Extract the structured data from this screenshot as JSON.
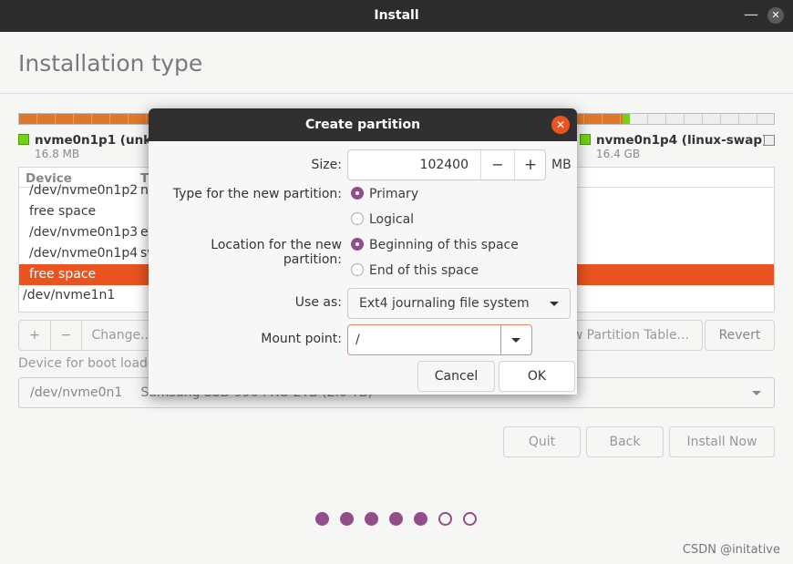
{
  "window": {
    "title": "Install"
  },
  "page": {
    "title": "Installation type"
  },
  "colors": {
    "accent": "#e95420",
    "ext4": "#f08a30",
    "swap": "#73d216",
    "progress": "#924d8b"
  },
  "legend": [
    {
      "name": "nvme0n1p1 (unkn",
      "size": "16.8 MB"
    },
    {
      "name": "nvme0n1p4 (linux-swap)",
      "size": "16.4 GB"
    }
  ],
  "table": {
    "headers": [
      "Device",
      "T"
    ],
    "rows": [
      {
        "device": "/dev/nvme0n1p2",
        "type": "nt"
      },
      {
        "device": "free space",
        "type": ""
      },
      {
        "device": "/dev/nvme0n1p3",
        "type": "ef"
      },
      {
        "device": "/dev/nvme0n1p4",
        "type": "sw"
      },
      {
        "device": "free space",
        "type": "",
        "selected": true
      },
      {
        "device": "/dev/nvme1n1",
        "type": ""
      }
    ]
  },
  "toolbar": {
    "add": "+",
    "remove": "−",
    "change": "Change...",
    "new_table": "New Partition Table...",
    "revert": "Revert"
  },
  "bootloader": {
    "label": "Device for boot loader installation:",
    "device": "/dev/nvme0n1",
    "model": "Samsung SSD 990 PRO 2TB (2.0 TB)"
  },
  "nav": {
    "quit": "Quit",
    "back": "Back",
    "install": "Install Now"
  },
  "progress": {
    "total": 7,
    "completed": 5
  },
  "watermark": "CSDN @initative",
  "dialog": {
    "title": "Create partition",
    "size_label": "Size:",
    "size_value": "102400",
    "size_unit": "MB",
    "dec": "−",
    "inc": "+",
    "type_label": "Type for the new partition:",
    "type_options": [
      "Primary",
      "Logical"
    ],
    "type_selected": "Primary",
    "location_label": "Location for the new partition:",
    "location_options": [
      "Beginning of this space",
      "End of this space"
    ],
    "location_selected": "Beginning of this space",
    "use_as_label": "Use as:",
    "use_as_value": "Ext4 journaling file system",
    "mount_label": "Mount point:",
    "mount_value": "/",
    "cancel": "Cancel",
    "ok": "OK"
  }
}
